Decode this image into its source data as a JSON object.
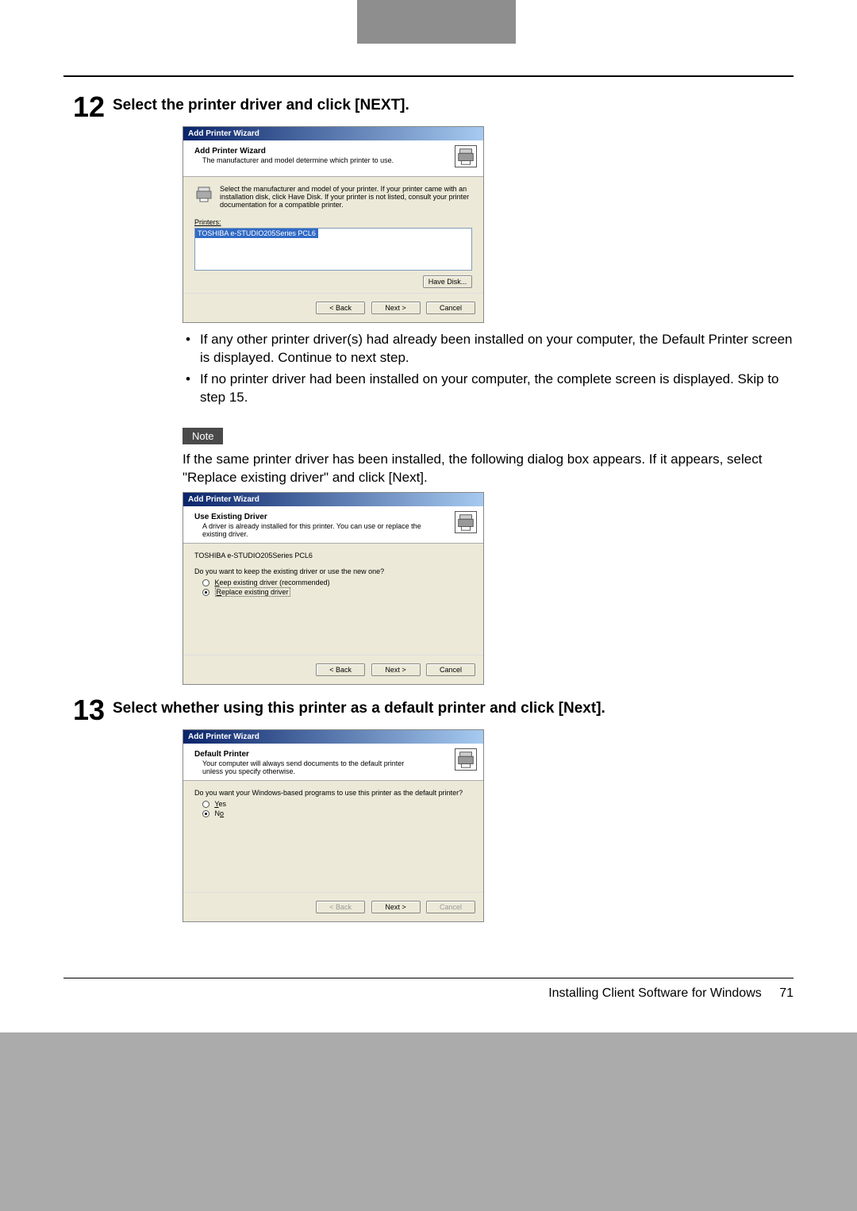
{
  "page": {
    "step12_num": "12",
    "step12_title": "Select the printer driver and click [NEXT].",
    "step13_num": "13",
    "step13_title": "Select whether using this printer as a default printer and click [Next].",
    "bullet1": "If any other printer driver(s) had already been installed on your computer, the Default Printer screen is displayed.  Continue to next step.",
    "bullet2": "If no printer driver had been installed on your computer, the complete screen is displayed.  Skip to step 15.",
    "note_label": "Note",
    "note_text": "If the same printer driver has been installed, the following dialog box appears.  If it appears, select \"Replace existing driver\" and click [Next].",
    "footer_text": "Installing Client Software for Windows",
    "footer_page": "71"
  },
  "wiz1": {
    "title": "Add Printer Wizard",
    "head_title": "Add Printer Wizard",
    "head_sub": "The manufacturer and model determine which printer to use.",
    "body_text": "Select the manufacturer and model of your printer. If your printer came with an installation disk, click Have Disk. If your printer is not listed, consult your printer documentation for a compatible printer.",
    "printers_label": "Printers:",
    "list_item": "TOSHIBA e-STUDIO205Series PCL6",
    "have_disk": "Have Disk...",
    "back": "< Back",
    "next": "Next >",
    "cancel": "Cancel"
  },
  "wiz2": {
    "title": "Add Printer Wizard",
    "head_title": "Use Existing Driver",
    "head_sub": "A driver is already installed for this printer. You can use or replace the existing driver.",
    "model": "TOSHIBA e-STUDIO205Series PCL6",
    "question": "Do you want to keep the existing driver or use the new one?",
    "opt1_pre": "K",
    "opt1_rest": "eep existing driver (recommended)",
    "opt2_pre": "R",
    "opt2_rest": "eplace existing driver",
    "back": "< Back",
    "next": "Next >",
    "cancel": "Cancel"
  },
  "wiz3": {
    "title": "Add Printer Wizard",
    "head_title": "Default Printer",
    "head_sub": "Your computer will always send documents to the default printer unless you specify otherwise.",
    "question": "Do you want your Windows-based programs to use this printer as the default printer?",
    "opt_yes_u": "Y",
    "opt_yes_rest": "es",
    "opt_no_u": "o",
    "opt_no_pre": "N",
    "back": "< Back",
    "next": "Next >",
    "cancel": "Cancel"
  }
}
